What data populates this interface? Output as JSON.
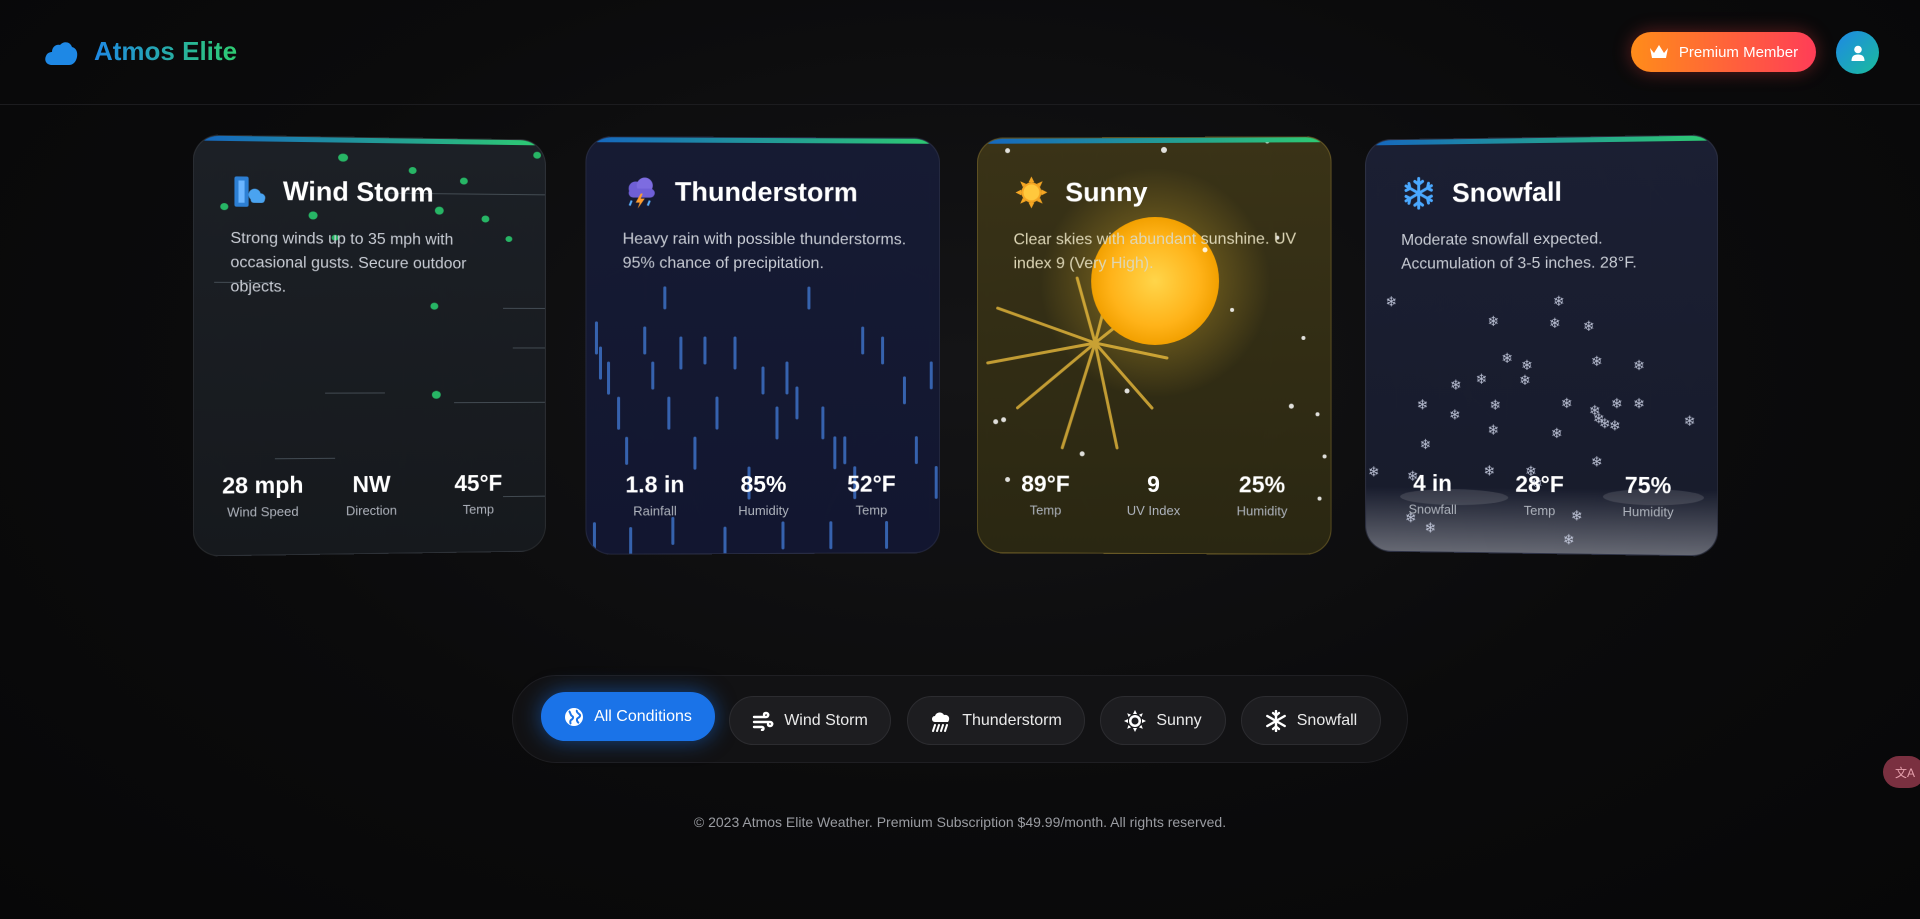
{
  "header": {
    "brand": "Atmos Elite",
    "premium_label": "Premium Member"
  },
  "cards": [
    {
      "title": "Wind Storm",
      "icon": "wind-storm-icon",
      "description": "Strong winds up to 35 mph with occasional gusts. Secure outdoor objects.",
      "stats": [
        {
          "value": "28 mph",
          "label": "Wind Speed"
        },
        {
          "value": "NW",
          "label": "Direction"
        },
        {
          "value": "45°F",
          "label": "Temp"
        }
      ]
    },
    {
      "title": "Thunderstorm",
      "icon": "thunderstorm-icon",
      "description": "Heavy rain with possible thunderstorms. 95% chance of precipitation.",
      "stats": [
        {
          "value": "1.8 in",
          "label": "Rainfall"
        },
        {
          "value": "85%",
          "label": "Humidity"
        },
        {
          "value": "52°F",
          "label": "Temp"
        }
      ]
    },
    {
      "title": "Sunny",
      "icon": "sun-icon",
      "description": "Clear skies with abundant sunshine. UV index 9 (Very High).",
      "stats": [
        {
          "value": "89°F",
          "label": "Temp"
        },
        {
          "value": "9",
          "label": "UV Index"
        },
        {
          "value": "25%",
          "label": "Humidity"
        }
      ]
    },
    {
      "title": "Snowfall",
      "icon": "snowflake-icon",
      "description": "Moderate snowfall expected. Accumulation of 3-5 inches. 28°F.",
      "stats": [
        {
          "value": "4 in",
          "label": "Snowfall"
        },
        {
          "value": "28°F",
          "label": "Temp"
        },
        {
          "value": "75%",
          "label": "Humidity"
        }
      ]
    }
  ],
  "filters": [
    {
      "label": "All Conditions",
      "icon": "globe-icon",
      "active": true
    },
    {
      "label": "Wind Storm",
      "icon": "wind-icon",
      "active": false
    },
    {
      "label": "Thunderstorm",
      "icon": "cloud-rain-icon",
      "active": false
    },
    {
      "label": "Sunny",
      "icon": "sun-icon",
      "active": false
    },
    {
      "label": "Snowfall",
      "icon": "snowflake-icon",
      "active": false
    }
  ],
  "footer": "© 2023 Atmos Elite Weather. Premium Subscription $49.99/month. All rights reserved.",
  "translate_label": "文A",
  "colors": {
    "accent_blue": "#1a73e8",
    "accent_green": "#2ecc71",
    "premium_orange": "#ff8c1a",
    "premium_red": "#ff3d57"
  }
}
